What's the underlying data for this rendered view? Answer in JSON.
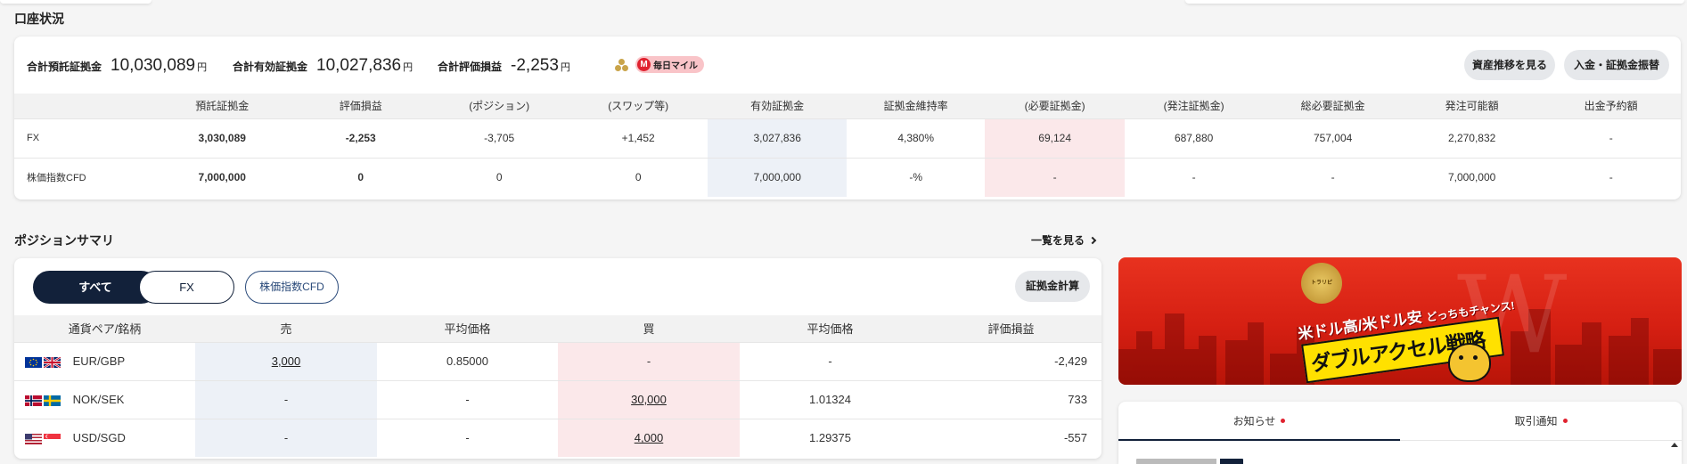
{
  "account": {
    "title": "口座状況",
    "total_deposit_label": "合計預託証拠金",
    "total_deposit_value": "10,030,089",
    "total_effective_label": "合計有効証拠金",
    "total_effective_value": "10,027,836",
    "total_pl_label": "合計評価損益",
    "total_pl_value": "-2,253",
    "unit": "円",
    "mileage_label": "毎日マイル",
    "mileage_badge_letter": "M",
    "asset_history_button": "資産推移を見る",
    "deposit_transfer_button": "入金・証拠金振替",
    "table": {
      "headers": [
        "",
        "預託証拠金",
        "評価損益",
        "(ポジション)",
        "(スワップ等)",
        "有効証拠金",
        "証拠金維持率",
        "(必要証拠金)",
        "(発注証拠金)",
        "総必要証拠金",
        "発注可能額",
        "出金予約額"
      ],
      "rows": [
        [
          "FX",
          "3,030,089",
          "-2,253",
          "-3,705",
          "+1,452",
          "3,027,836",
          "4,380%",
          "69,124",
          "687,880",
          "757,004",
          "2,270,832",
          "-"
        ],
        [
          "株価指数CFD",
          "7,000,000",
          "0",
          "0",
          "0",
          "7,000,000",
          "-%",
          "-",
          "-",
          "-",
          "7,000,000",
          "-"
        ]
      ]
    }
  },
  "positions": {
    "title": "ポジションサマリ",
    "view_all": "一覧を見る",
    "filters": {
      "all": "すべて",
      "fx": "FX",
      "cfd": "株価指数CFD"
    },
    "margin_calc_button": "証拠金計算",
    "table": {
      "headers": [
        "通貨ペア/銘柄",
        "売",
        "平均価格",
        "買",
        "平均価格",
        "評価損益"
      ],
      "rows": [
        {
          "pair": "EUR/GBP",
          "flags": [
            "eu",
            "uk"
          ],
          "sell": "3,000",
          "sell_avg": "0.85000",
          "buy": "-",
          "buy_avg": "-",
          "pl": "-2,429"
        },
        {
          "pair": "NOK/SEK",
          "flags": [
            "no",
            "se"
          ],
          "sell": "-",
          "sell_avg": "-",
          "buy": "30,000",
          "buy_avg": "1.01324",
          "pl": "733"
        },
        {
          "pair": "USD/SGD",
          "flags": [
            "us",
            "sg"
          ],
          "sell": "-",
          "sell_avg": "-",
          "buy": "4,000",
          "buy_avg": "1.29375",
          "pl": "-557"
        }
      ]
    }
  },
  "banner": {
    "line1_a": "米ドル高",
    "line1_b": "米ドル安",
    "line1_c": "どっちもチャンス!",
    "line2": "ダブルアクセル戦略",
    "medal": "トラリピ"
  },
  "news": {
    "tab_notice": "お知らせ",
    "tab_trade": "取引通知"
  },
  "colors": {
    "navy": "#12213a",
    "sell_bg": "#edf1f7",
    "buy_bg": "#fbe8ea",
    "accent_red": "#e0222f"
  }
}
